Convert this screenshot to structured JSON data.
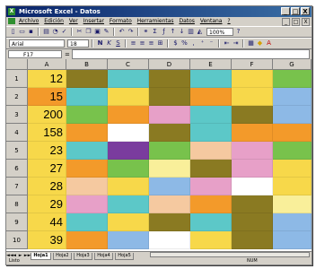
{
  "window": {
    "title": "Microsoft Excel - Datos",
    "app_icon": "excel-icon",
    "buttons": [
      "_",
      "□",
      "X"
    ]
  },
  "menubar": {
    "items": [
      "Archivo",
      "Edición",
      "Ver",
      "Insertar",
      "Formato",
      "Herramientas",
      "Datos",
      "Ventana",
      "?"
    ],
    "doc_buttons": [
      "_",
      "□",
      "X"
    ]
  },
  "toolbar_standard": {
    "icons": [
      "new-icon",
      "open-icon",
      "save-icon",
      "print-icon",
      "preview-icon",
      "spell-icon",
      "cut-icon",
      "copy-icon",
      "paste-icon",
      "format-painter-icon",
      "undo-icon",
      "redo-icon",
      "hyperlink-icon",
      "autosum-icon",
      "function-icon",
      "sort-asc-icon",
      "sort-desc-icon",
      "chart-icon",
      "drawing-icon"
    ],
    "zoom": "100%"
  },
  "toolbar_format": {
    "font_name": "Arial",
    "font_size": "18",
    "buttons": [
      "N",
      "K",
      "S"
    ],
    "align_icons": [
      "align-left-icon",
      "align-center-icon",
      "align-right-icon",
      "merge-icon"
    ],
    "number_icons": [
      "currency-icon",
      "percent-icon",
      "thousands-icon",
      "increase-decimal-icon",
      "decrease-decimal-icon"
    ],
    "indent_icons": [
      "decrease-indent-icon",
      "increase-indent-icon"
    ],
    "color_icons": [
      "borders-icon",
      "fill-color-icon",
      "font-color-icon"
    ]
  },
  "formula_bar": {
    "name_box": "F17",
    "fx": "=",
    "content": ""
  },
  "columns": [
    "A",
    "B",
    "C",
    "D",
    "E",
    "F",
    "G"
  ],
  "rows": [
    "1",
    "2",
    "3",
    "4",
    "5",
    "6",
    "7",
    "8",
    "9",
    "10"
  ],
  "values_col_a": [
    "12",
    "15",
    "200",
    "158",
    "23",
    "27",
    "28",
    "29",
    "44",
    "39"
  ],
  "colors": {
    "orange": "#f39a2a",
    "yellow": "#f7d84a",
    "olive": "#8a7a22",
    "cyan": "#5cc8c8",
    "green": "#78c24c",
    "pink": "#e7a0c8",
    "blue": "#8db9e6",
    "purple": "#7a3c9e",
    "white": "#ffffff",
    "peach": "#f5c9a0",
    "lightyellow": "#f9ef9a"
  },
  "grid_colors": [
    [
      "yellow",
      "olive",
      "cyan",
      "olive",
      "cyan",
      "yellow",
      "green"
    ],
    [
      "orange",
      "cyan",
      "yellow",
      "olive",
      "orange",
      "yellow",
      "blue"
    ],
    [
      "yellow",
      "green",
      "orange",
      "pink",
      "cyan",
      "olive",
      "blue"
    ],
    [
      "yellow",
      "orange",
      "white",
      "olive",
      "cyan",
      "orange",
      "orange"
    ],
    [
      "yellow",
      "cyan",
      "purple",
      "green",
      "peach",
      "pink",
      "green"
    ],
    [
      "yellow",
      "orange",
      "green",
      "lightyellow",
      "olive",
      "pink",
      "yellow"
    ],
    [
      "yellow",
      "peach",
      "yellow",
      "blue",
      "pink",
      "white",
      "yellow"
    ],
    [
      "yellow",
      "pink",
      "cyan",
      "peach",
      "orange",
      "olive",
      "lightyellow"
    ],
    [
      "yellow",
      "cyan",
      "yellow",
      "olive",
      "cyan",
      "olive",
      "blue"
    ],
    [
      "yellow",
      "orange",
      "blue",
      "white",
      "yellow",
      "olive",
      "blue"
    ]
  ],
  "sheet_tabs": [
    "Hoja1",
    "Hoja2",
    "Hoja3",
    "Hoja4",
    "Hoja5"
  ],
  "sheet_nav": [
    "◄◄",
    "◄",
    "►",
    "►►"
  ],
  "status": {
    "mode": "Listo",
    "num": "NUM"
  }
}
